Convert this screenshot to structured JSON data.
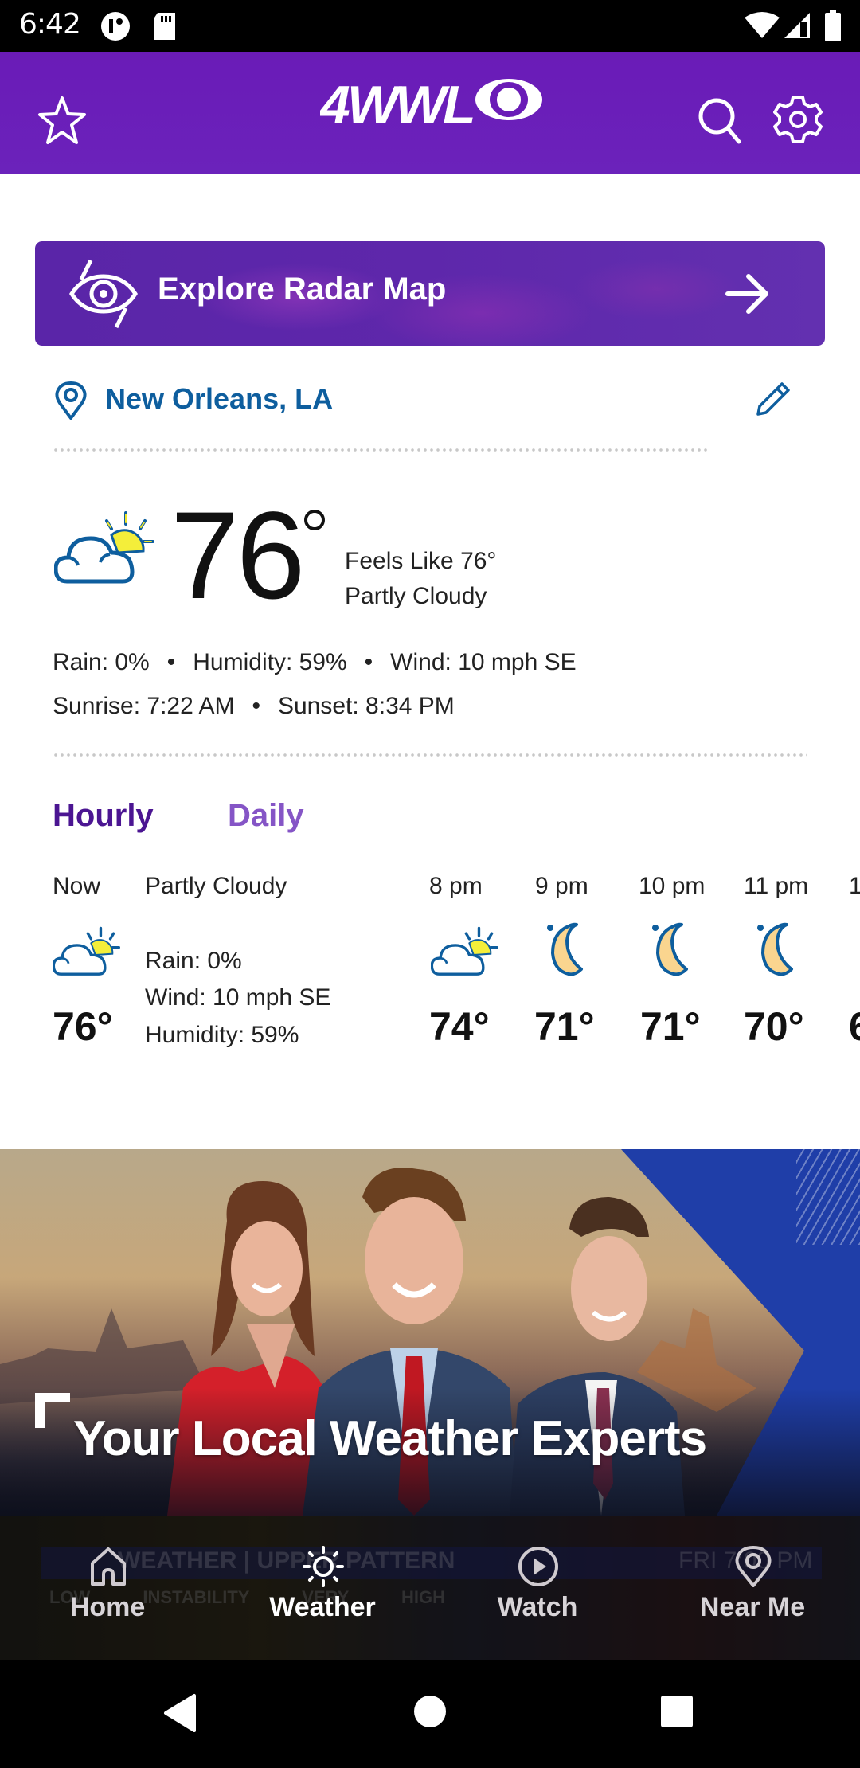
{
  "status_bar": {
    "time": "6:42",
    "icons": [
      "notification-icon",
      "sd-card-icon",
      "wifi-icon",
      "signal-icon",
      "battery-icon"
    ]
  },
  "header": {
    "logo_text": "4WWL",
    "brand_color": "#6a1bb7",
    "left_icon": "star-icon",
    "right_icons": [
      "search-icon",
      "settings-icon"
    ]
  },
  "radar": {
    "label": "Explore Radar Map",
    "icon": "radar-icon",
    "action_icon": "arrow-right-icon"
  },
  "location": {
    "name": "New Orleans, LA",
    "color": "#0e5e9e",
    "edit_icon": "pencil-icon"
  },
  "current": {
    "icon": "partly-cloudy-icon",
    "temperature": "76",
    "feels_like": "Feels Like 76°",
    "condition": "Partly Cloudy",
    "rain": "Rain: 0%",
    "humidity": "Humidity: 59%",
    "wind": "Wind: 10 mph SE",
    "sunrise": "Sunrise: 7:22 AM",
    "sunset": "Sunset: 8:34 PM",
    "separator": "•"
  },
  "tabs": {
    "hourly": "Hourly",
    "daily": "Daily",
    "active": "Hourly"
  },
  "hourly": {
    "now": {
      "label": "Now",
      "condition": "Partly Cloudy",
      "icon": "partly-cloudy-icon",
      "temp": "76°",
      "rain": "Rain: 0%",
      "wind": "Wind: 10 mph SE",
      "humidity": "Humidity: 59%"
    },
    "hours": [
      {
        "label": "8 pm",
        "icon": "partly-cloudy-icon",
        "temp": "74°"
      },
      {
        "label": "9 pm",
        "icon": "moon-icon",
        "temp": "71°"
      },
      {
        "label": "10 pm",
        "icon": "moon-icon",
        "temp": "71°"
      },
      {
        "label": "11 pm",
        "icon": "moon-icon",
        "temp": "70°"
      },
      {
        "label": "1",
        "icon": "",
        "temp": "6"
      }
    ]
  },
  "promo": {
    "title": "Your Local Weather Experts"
  },
  "bottom_nav": {
    "background_video": {
      "title": "WEATHER | UPPER PATTERN",
      "time": "FRI 7:00 PM",
      "scale": "LOW INSTABILITY VERY HIGH"
    },
    "items": [
      {
        "label": "Home",
        "icon": "home-icon",
        "active": false
      },
      {
        "label": "Weather",
        "icon": "sun-icon",
        "active": true
      },
      {
        "label": "Watch",
        "icon": "play-circle-icon",
        "active": false
      },
      {
        "label": "Near Me",
        "icon": "location-pin-icon",
        "active": false
      }
    ]
  },
  "system_nav": [
    "back-button",
    "home-button",
    "recents-button"
  ]
}
